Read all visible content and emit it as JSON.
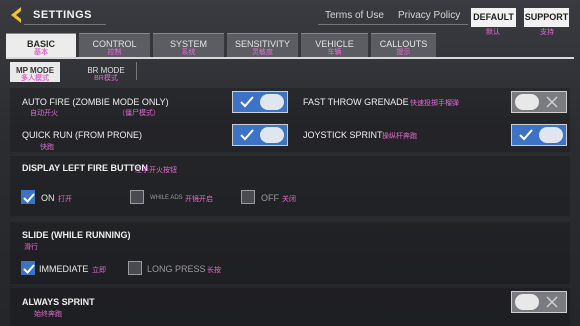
{
  "header": {
    "title": "SETTINGS",
    "links": {
      "terms": "Terms of Use",
      "privacy": "Privacy Policy"
    },
    "buttons": {
      "default": {
        "label": "DEFAULT",
        "sub": "默认"
      },
      "support": {
        "label": "SUPPORT",
        "sub": "支持"
      }
    }
  },
  "tabs": [
    {
      "label": "BASIC",
      "sub": "基本"
    },
    {
      "label": "CONTROL",
      "sub": "控制"
    },
    {
      "label": "SYSTEM",
      "sub": "系统"
    },
    {
      "label": "SENSITIVITY",
      "sub": "灵敏度"
    },
    {
      "label": "VEHICLE",
      "sub": "车辆"
    },
    {
      "label": "CALLOUTS",
      "sub": "提示"
    }
  ],
  "modes": [
    {
      "label": "MP MODE",
      "sub": "多人模式"
    },
    {
      "label": "BR MODE",
      "sub": "BR模式"
    }
  ],
  "settings": {
    "auto_fire": {
      "label": "AUTO FIRE (ZOMBIE MODE ONLY)",
      "sub": "自动开火",
      "sub2": "（僵尸模式）",
      "state": "on"
    },
    "fast_throw": {
      "label": "FAST THROW GRENADE",
      "sub": "快速投掷手榴弹",
      "state": "off"
    },
    "quick_run": {
      "label": "QUICK RUN (FROM PRONE)",
      "sub": "快跑",
      "state": "on"
    },
    "joystick_sprint": {
      "label": "JOYSTICK SPRINT",
      "sub": "操纵杆奔跑",
      "state": "on"
    }
  },
  "display_left_fire": {
    "title": "DISPLAY LEFT FIRE BUTTON",
    "title_sub": "左手开火按钮",
    "options": [
      {
        "label": "ON",
        "sub": "打开",
        "checked": true
      },
      {
        "label": "WHILE ADS",
        "sub": "开镜开启",
        "checked": false
      },
      {
        "label": "OFF",
        "sub": "关闭",
        "checked": false
      }
    ]
  },
  "slide": {
    "title": "SLIDE (WHILE RUNNING)",
    "title_sub": "滑行",
    "options": [
      {
        "label": "IMMEDIATE",
        "sub": "立即",
        "checked": true
      },
      {
        "label": "LONG PRESS",
        "sub": "长按",
        "checked": false
      }
    ]
  },
  "always_sprint": {
    "label": "ALWAYS SPRINT",
    "sub": "始终奔跑",
    "state": "off"
  },
  "colors": {
    "accent": "#3c73c4",
    "chinese_sub": "#e36bd1",
    "panel": "#2c2d31"
  }
}
